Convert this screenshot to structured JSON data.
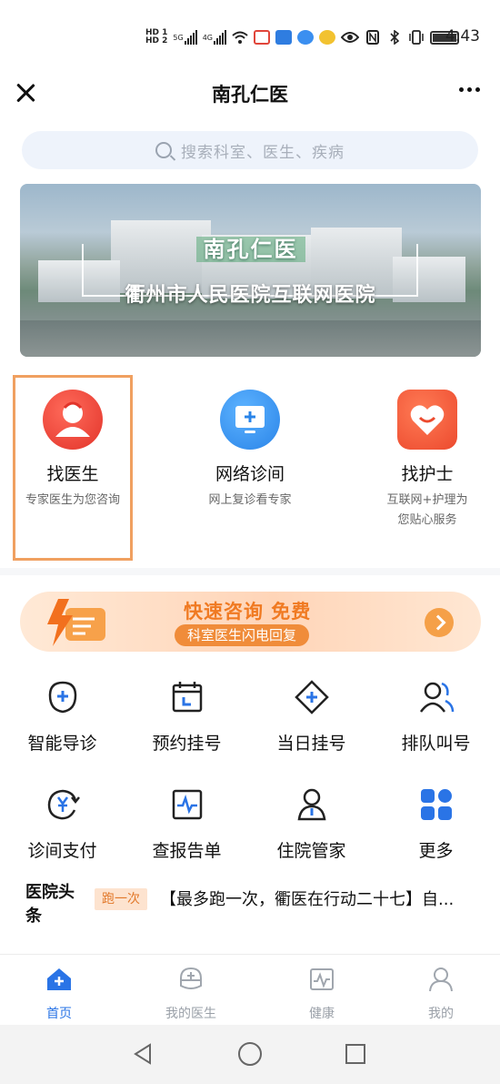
{
  "status_bar": {
    "time": "4:43",
    "hd1": "HD 1",
    "hd2": "HD 2",
    "net1": "5G",
    "net2": "4G"
  },
  "titlebar": {
    "title": "南孔仁医"
  },
  "search": {
    "placeholder": "搜索科室、医生、疾病"
  },
  "banner": {
    "title": "南孔仁医",
    "subtitle": "衢州市人民医院互联网医院"
  },
  "services": [
    {
      "title": "找医生",
      "desc": "专家医生为您咨询",
      "icon": "doctor-icon",
      "color": "#ef4b3c"
    },
    {
      "title": "网络诊间",
      "desc": "网上复诊看专家",
      "icon": "monitor-icon",
      "color": "#3b9af0"
    },
    {
      "title": "找护士",
      "desc": "互联网+护理为您贴心服务",
      "icon": "heart-icon",
      "color": "#f05a3c"
    }
  ],
  "promo": {
    "title": "快速咨询 免费",
    "tag": "科室医生闪电回复"
  },
  "grid": [
    {
      "label": "智能导诊",
      "icon": "guide-icon"
    },
    {
      "label": "预约挂号",
      "icon": "calendar-icon"
    },
    {
      "label": "当日挂号",
      "icon": "diamond-plus-icon"
    },
    {
      "label": "排队叫号",
      "icon": "queue-icon"
    },
    {
      "label": "诊间支付",
      "icon": "payment-icon"
    },
    {
      "label": "查报告单",
      "icon": "report-icon"
    },
    {
      "label": "住院管家",
      "icon": "inpatient-icon"
    },
    {
      "label": "更多",
      "icon": "more-grid-icon"
    }
  ],
  "news": {
    "logo": "医院头条",
    "badge": "跑一次",
    "text": "【最多跑一次，衢医在行动二十七】自..."
  },
  "tabbar": [
    {
      "label": "首页",
      "active": true
    },
    {
      "label": "我的医生",
      "active": false
    },
    {
      "label": "健康",
      "active": false
    },
    {
      "label": "我的",
      "active": false
    }
  ],
  "colors": {
    "accent": "#2a74e6",
    "promo": "#f07a22",
    "highlight": "#f0a060"
  }
}
